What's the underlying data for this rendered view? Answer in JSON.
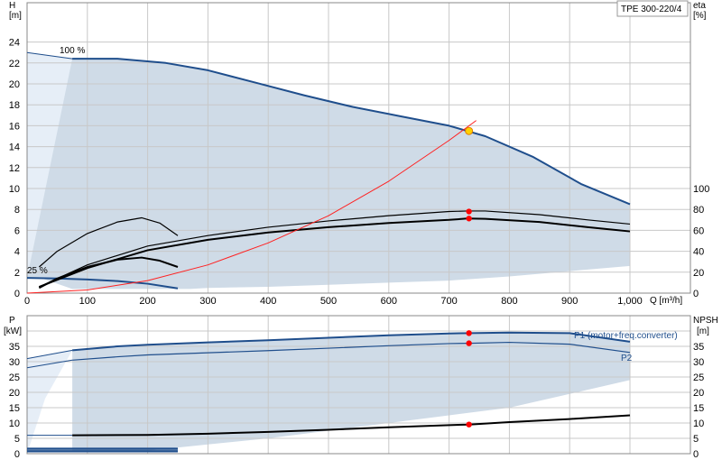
{
  "chart_data": [
    {
      "type": "line",
      "panel": "head-efficiency",
      "title": "TPE 300-220/4",
      "xlabel": "Q [m³/h]",
      "xlim": [
        0,
        1000
      ],
      "x_ticks": [
        "0",
        "100",
        "200",
        "300",
        "400",
        "500",
        "600",
        "700",
        "800",
        "900",
        "1,000"
      ],
      "ylabel_left": [
        "H",
        "[m]"
      ],
      "ylim_left": [
        0,
        24
      ],
      "yticks_left": [
        "0",
        "2",
        "4",
        "6",
        "8",
        "10",
        "12",
        "14",
        "16",
        "18",
        "20",
        "22",
        "24"
      ],
      "ylabel_right": [
        "eta",
        "[%]"
      ],
      "ylim_right": [
        0,
        100
      ],
      "yticks_right": [
        "0",
        "20",
        "40",
        "60",
        "80",
        "100"
      ],
      "grid": true,
      "annotations": [
        "100 %",
        "25 %"
      ],
      "colors": {
        "curve": "#1f4e8c",
        "shade": "#cfdbe7",
        "shade_light": "#e6eef7",
        "system": "#ff2020",
        "dot": "#ff0000",
        "duty": "#ffd200"
      },
      "operating_range_upper": {
        "x": [
          75,
          150,
          230,
          300,
          380,
          460,
          540,
          620,
          700,
          730,
          760,
          840,
          920,
          1000
        ],
        "y": [
          22.4,
          22.4,
          22.0,
          21.3,
          20.1,
          18.9,
          17.8,
          16.9,
          16.0,
          15.5,
          15.0,
          13.0,
          10.4,
          8.5
        ]
      },
      "operating_range_lower": {
        "x": [
          1000,
          900,
          800,
          700,
          600,
          500,
          400,
          300,
          270,
          230,
          200,
          75,
          25,
          0
        ],
        "y": [
          2.6,
          2.1,
          1.6,
          1.2,
          1.0,
          0.8,
          0.6,
          0.5,
          0.4,
          0.4,
          0.4,
          0.4,
          1.4,
          1.45
        ]
      },
      "light_region": [
        [
          0,
          23.0
        ],
        [
          75,
          22.4
        ],
        [
          50,
          12.0
        ],
        [
          25,
          1.4
        ],
        [
          0,
          1.45
        ]
      ],
      "series": [
        {
          "name": "100 %",
          "axis": "left",
          "x": [
            75,
            150,
            230,
            300,
            380,
            460,
            540,
            620,
            700,
            730,
            760,
            840,
            920,
            1000
          ],
          "y": [
            22.4,
            22.4,
            22.0,
            21.3,
            20.1,
            18.9,
            17.8,
            16.9,
            16.0,
            15.5,
            15.0,
            13.0,
            10.4,
            8.5
          ]
        },
        {
          "name": "25 %",
          "axis": "left",
          "x": [
            0,
            50,
            100,
            150,
            200,
            250
          ],
          "y": [
            1.45,
            1.4,
            1.3,
            1.15,
            0.9,
            0.45
          ]
        },
        {
          "name": "eta 100 % (pump)",
          "axis": "right",
          "x": [
            20,
            100,
            200,
            300,
            400,
            500,
            600,
            700,
            730,
            760,
            850,
            930,
            1000
          ],
          "y": [
            6,
            27,
            45,
            55,
            63,
            69,
            74,
            78,
            78.5,
            78.5,
            75,
            70,
            66
          ]
        },
        {
          "name": "eta 100 % (total)",
          "axis": "right",
          "x": [
            20,
            100,
            200,
            300,
            400,
            500,
            600,
            700,
            730,
            760,
            850,
            930,
            1000
          ],
          "y": [
            6,
            24,
            41,
            51,
            58,
            63,
            67,
            70,
            71.3,
            71,
            68,
            63,
            59
          ]
        },
        {
          "name": "eta 25 % (pump)",
          "axis": "right",
          "x": [
            20,
            50,
            100,
            150,
            190,
            220,
            250
          ],
          "y": [
            25,
            40,
            57,
            68,
            72,
            67,
            55
          ]
        },
        {
          "name": "eta 25 % (total)",
          "axis": "right",
          "x": [
            20,
            50,
            100,
            150,
            190,
            220,
            250
          ],
          "y": [
            5,
            14,
            25,
            32,
            34,
            31,
            25
          ]
        },
        {
          "name": "system curve",
          "axis": "left",
          "x": [
            0,
            100,
            200,
            300,
            400,
            500,
            600,
            700,
            745
          ],
          "y": [
            0.0,
            0.3,
            1.2,
            2.7,
            4.8,
            7.4,
            10.7,
            14.6,
            16.5
          ]
        }
      ],
      "duty_point": {
        "x": 733,
        "y": 15.5
      },
      "eta_points": [
        {
          "x": 733,
          "y": 78
        },
        {
          "x": 733,
          "y": 71.3
        }
      ]
    },
    {
      "type": "line",
      "panel": "power-npsh",
      "xlim": [
        0,
        1000
      ],
      "ylabel_left": [
        "P",
        "[kW]"
      ],
      "ylim_left": [
        0,
        40
      ],
      "yticks_left": [
        "0",
        "5",
        "10",
        "15",
        "20",
        "25",
        "30",
        "35"
      ],
      "ylabel_right": [
        "NPSH",
        "[m]"
      ],
      "ylim_right": [
        0,
        40
      ],
      "yticks_right": [
        "0",
        "5",
        "10",
        "15",
        "20",
        "25",
        "30",
        "35"
      ],
      "grid": true,
      "power_range_upper": {
        "x": [
          75,
          200,
          400,
          600,
          700,
          733,
          800,
          900,
          1000
        ],
        "y": [
          33.7,
          35.5,
          37.0,
          38.6,
          39.2,
          39.3,
          39.5,
          39.3,
          36.5
        ]
      },
      "power_range_lower": {
        "x": [
          1000,
          900,
          800,
          700,
          600,
          500,
          400,
          300,
          200,
          75
        ],
        "y": [
          24.0,
          19.5,
          15.0,
          12.5,
          10.0,
          7.5,
          5.0,
          3.0,
          1.0,
          0.5
        ]
      },
      "light_region": [
        [
          0,
          31.0
        ],
        [
          75,
          33.7
        ],
        [
          30,
          18.0
        ],
        [
          0,
          0
        ]
      ],
      "series": [
        {
          "name": "P1 (motor+freq.converter)",
          "axis": "left",
          "x": [
            75,
            150,
            200,
            300,
            400,
            500,
            600,
            700,
            733,
            800,
            900,
            1000
          ],
          "y": [
            33.7,
            35.0,
            35.5,
            36.3,
            37.0,
            37.8,
            38.6,
            39.2,
            39.3,
            39.5,
            39.3,
            36.5
          ]
        },
        {
          "name": "P2",
          "axis": "left",
          "x": [
            75,
            150,
            200,
            300,
            400,
            500,
            600,
            700,
            733,
            800,
            900,
            1000
          ],
          "y": [
            30.5,
            31.6,
            32.2,
            32.9,
            33.6,
            34.4,
            35.2,
            35.9,
            36.0,
            36.3,
            35.7,
            33.0
          ]
        },
        {
          "name": "P1 extension",
          "axis": "left",
          "x": [
            0,
            75
          ],
          "y": [
            31.0,
            33.7
          ]
        },
        {
          "name": "P2 extension",
          "axis": "left",
          "x": [
            0,
            75
          ],
          "y": [
            28.0,
            30.5
          ]
        },
        {
          "name": "NPSH",
          "axis": "right",
          "x": [
            75,
            200,
            300,
            400,
            500,
            600,
            700,
            733,
            800,
            900,
            1000
          ],
          "y": [
            6.0,
            6.1,
            6.5,
            7.1,
            7.8,
            8.6,
            9.3,
            9.5,
            10.3,
            11.3,
            12.5
          ]
        },
        {
          "name": "P1 25 %",
          "axis": "left",
          "x": [
            0,
            250
          ],
          "y": [
            1.6,
            1.6
          ]
        },
        {
          "name": "P2 25 %",
          "axis": "left",
          "x": [
            0,
            250
          ],
          "y": [
            0.8,
            0.8
          ]
        }
      ],
      "npsh_extension": {
        "x": [
          0,
          75
        ],
        "y": [
          6.0,
          6.0
        ]
      },
      "duty_points": [
        {
          "axis": "left",
          "x": 733,
          "y": 39.3
        },
        {
          "axis": "left",
          "x": 733,
          "y": 36.0
        },
        {
          "axis": "right",
          "x": 733,
          "y": 9.5
        }
      ],
      "series_labels": [
        "P1 (motor+freq.converter)",
        "P2"
      ]
    }
  ]
}
